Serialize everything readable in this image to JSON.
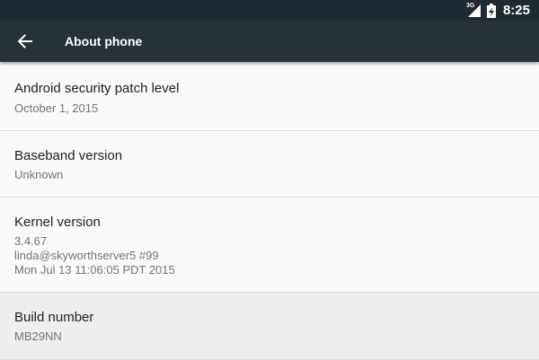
{
  "status_bar": {
    "network_label": "3G",
    "time": "8:25",
    "icons": [
      "signal-icon",
      "battery-icon"
    ]
  },
  "toolbar": {
    "back_icon": "arrow-back-icon",
    "title": "About phone"
  },
  "items": [
    {
      "title": "Android security patch level",
      "subtitle": [
        "October 1, 2015"
      ]
    },
    {
      "title": "Baseband version",
      "subtitle": [
        "Unknown"
      ]
    },
    {
      "title": "Kernel version",
      "subtitle": [
        "3.4.67",
        "linda@skyworthserver5 #99",
        "Mon Jul 13 11:06:05 PDT 2015"
      ]
    },
    {
      "title": "Build number",
      "subtitle": [
        "MB29NN"
      ],
      "pressed": true
    }
  ],
  "colors": {
    "status_bar": "#1e2a31",
    "toolbar": "#263238",
    "background": "#fafafa",
    "pressed_item": "#eeeeee"
  }
}
